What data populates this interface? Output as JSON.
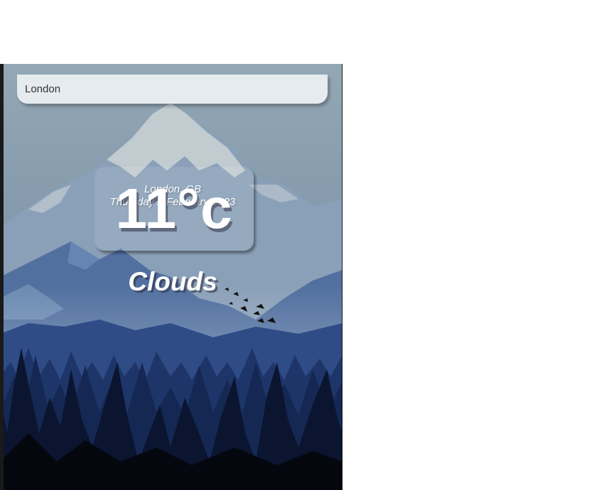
{
  "search": {
    "value": "London"
  },
  "location": {
    "city": "London, GB",
    "date": "Thursday 2 February 2023"
  },
  "weather": {
    "temperature": "11°c",
    "condition": "Clouds"
  },
  "background": {
    "icon": "mountain-forest-illustration",
    "sky_color": "#93a7b4",
    "mountain_color": "#c7cfd3",
    "forest_color": "#0c1831"
  }
}
